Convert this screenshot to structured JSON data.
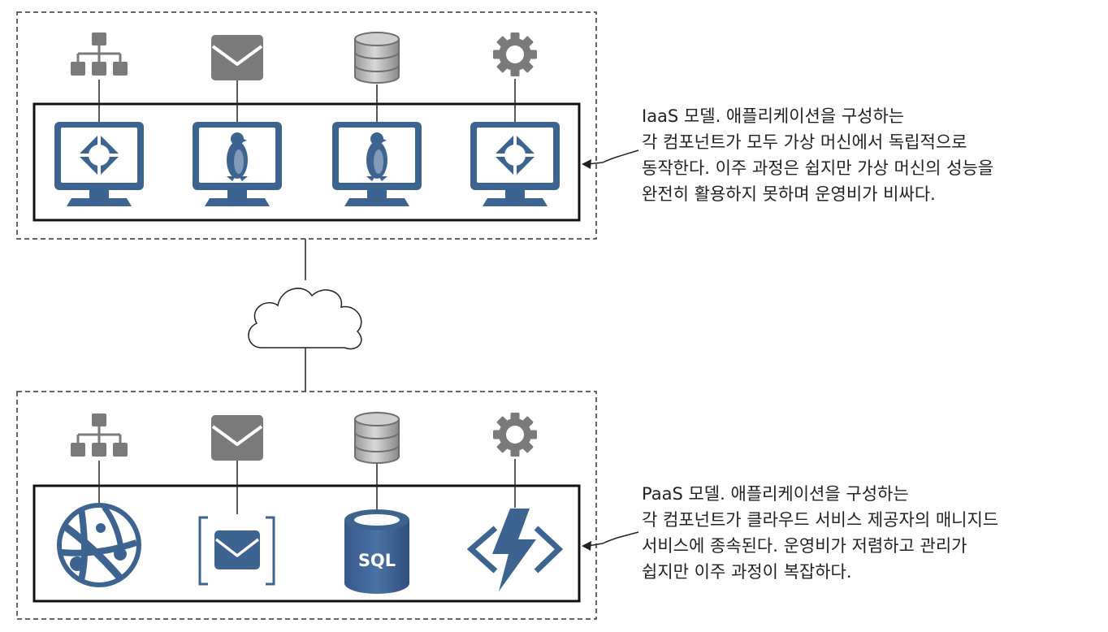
{
  "iaas": {
    "caption_lines": [
      "IaaS 모델. 애플리케이션을 구성하는",
      "각 컴포넌트가 모두 가상 머신에서 독립적으로",
      "동작한다. 이주 과정은 쉽지만 가상 머신의 성능을",
      "완전히 활용하지 못하며 운영비가 비싸다."
    ],
    "component_icons": [
      "hierarchy-icon",
      "mail-icon",
      "database-icon",
      "gear-icon"
    ],
    "vm_icons": [
      "vm-windows-icon",
      "vm-linux-icon",
      "vm-linux-icon",
      "vm-windows-icon"
    ]
  },
  "paas": {
    "caption_lines": [
      "PaaS 모델. 애플리케이션을 구성하는",
      "각 컴포넌트가 클라우드 서비스 제공자의 매니지드",
      "서비스에 종속된다. 운영비가 저렴하고 관리가",
      "쉽지만 이주 과정이 복잡하다."
    ],
    "component_icons": [
      "hierarchy-icon",
      "mail-icon",
      "database-icon",
      "gear-icon"
    ],
    "service_icons": [
      "web-app-service-icon",
      "message-queue-icon",
      "sql-database-icon",
      "function-icon"
    ],
    "sql_label": "SQL"
  },
  "colors": {
    "icon_gray": "#7a7a7a",
    "azure_blue": "#3d6491",
    "line": "#222222",
    "dash": "#333333"
  }
}
